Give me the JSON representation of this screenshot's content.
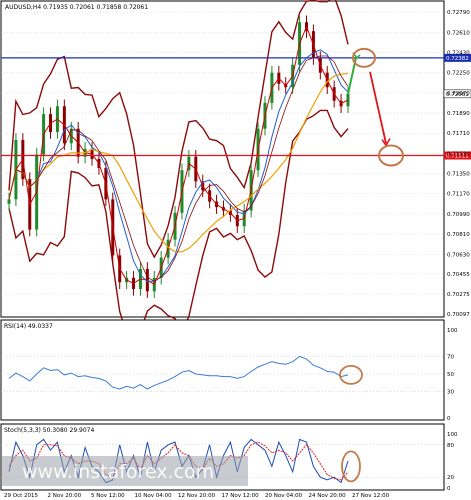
{
  "chart_data": {
    "type": "line",
    "symbol": "AUDUSD,H4",
    "ohlc_header": "AUDUSD,H4  0.71935 0.72061 0.71858 0.72061",
    "main": {
      "ylim": [
        0.70097,
        0.72809
      ],
      "y_ticks": [
        "0.72790",
        "0.72610",
        "0.72430",
        "0.72250",
        "0.72070",
        "0.71890",
        "0.71710",
        "0.71530",
        "0.71350",
        "0.71170",
        "0.70990",
        "0.70810",
        "0.70630",
        "0.70455",
        "0.70275",
        "0.70097"
      ],
      "resistance": {
        "label": "0.72382",
        "value": 0.72382,
        "color": "#1c2fb0"
      },
      "support": {
        "label": "0.71511",
        "value": 0.71511,
        "color": "#e0141a"
      },
      "price_tag": {
        "label": "0.72061",
        "value": 0.72061
      },
      "close_series": [
        0.7112,
        0.7165,
        0.713,
        0.7085,
        0.7152,
        0.7188,
        0.7172,
        0.7195,
        0.7162,
        0.7175,
        0.715,
        0.7157,
        0.7148,
        0.714,
        0.7112,
        0.7062,
        0.7038,
        0.7042,
        0.7032,
        0.705,
        0.703,
        0.7042,
        0.706,
        0.7076,
        0.71,
        0.7138,
        0.715,
        0.7128,
        0.712,
        0.711,
        0.7105,
        0.7102,
        0.7098,
        0.7088,
        0.7102,
        0.7138,
        0.7175,
        0.7198,
        0.7225,
        0.7215,
        0.7212,
        0.7232,
        0.727,
        0.7262,
        0.7238,
        0.7225,
        0.7212,
        0.72,
        0.7195,
        0.7206
      ]
    },
    "rsi": {
      "label": "RSI(14) 49.0337",
      "ylim": [
        0,
        100
      ],
      "levels": [
        70,
        50,
        30
      ],
      "tick_labels": [
        "100",
        "70",
        "50",
        "30",
        "0"
      ],
      "values": [
        45,
        51,
        47,
        42,
        50,
        57,
        54,
        55,
        49,
        51,
        47,
        48,
        46,
        45,
        42,
        35,
        33,
        36,
        34,
        38,
        33,
        37,
        40,
        43,
        47,
        52,
        54,
        50,
        49,
        48,
        48,
        47,
        47,
        45,
        47,
        53,
        58,
        61,
        64,
        62,
        61,
        64,
        70,
        67,
        60,
        57,
        53,
        52,
        47,
        49
      ]
    },
    "stoch": {
      "label": "Stoch(5,3,3) 50.3080 29.9074",
      "ylim": [
        0,
        100
      ],
      "levels": [
        80,
        20
      ],
      "tick_labels": [
        "100",
        "80",
        "20",
        "0"
      ],
      "k": [
        30,
        85,
        60,
        20,
        80,
        90,
        70,
        85,
        30,
        60,
        20,
        75,
        40,
        30,
        10,
        15,
        80,
        30,
        60,
        20,
        85,
        30,
        70,
        80,
        85,
        40,
        60,
        20,
        35,
        80,
        20,
        60,
        85,
        30,
        75,
        90,
        80,
        70,
        40,
        85,
        60,
        30,
        90,
        85,
        40,
        20,
        15,
        20,
        10,
        50
      ],
      "d": [
        40,
        60,
        70,
        50,
        55,
        80,
        80,
        78,
        60,
        55,
        45,
        50,
        50,
        45,
        25,
        20,
        45,
        45,
        55,
        35,
        60,
        45,
        55,
        65,
        80,
        65,
        60,
        40,
        35,
        55,
        40,
        45,
        60,
        55,
        60,
        80,
        85,
        78,
        65,
        70,
        65,
        50,
        65,
        80,
        65,
        45,
        25,
        18,
        15,
        30
      ]
    },
    "x_tick_labels": [
      "29 Oct 2015",
      "2 Nov 20:00",
      "5 Nov 12:00",
      "10 Nov 04:00",
      "12 Nov 20:00",
      "17 Nov 12:00",
      "20 Nov 04:00",
      "24 Nov 20:00",
      "27 Nov 12:00"
    ],
    "colors": {
      "candle": "#1f8a2a",
      "candle_dn": "#8b0000",
      "bb": "#8b0a0a",
      "ma_fast": "#d10000",
      "ma_mid": "#1e62d0",
      "ma_slow": "#f0a000",
      "rsi": "#3a7bd5",
      "stoch_k": "#1e4bb5",
      "stoch_d": "#e02020",
      "arrow_up": "#2fae3a",
      "arrow_dn": "#e0141a",
      "circle": "#c47a4a"
    },
    "watermark": "www.instaforex.com"
  }
}
